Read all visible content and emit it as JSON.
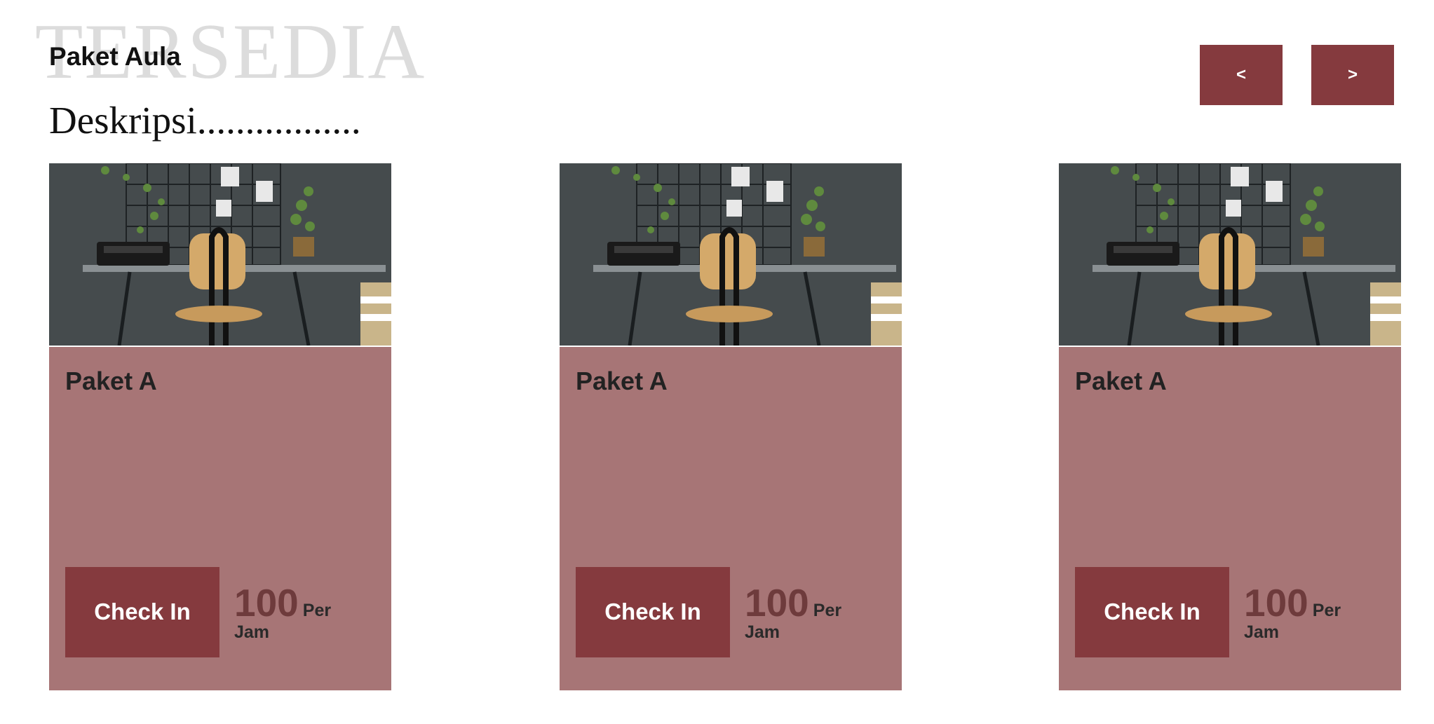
{
  "header": {
    "watermark": "TERSEDIA",
    "title": "Paket Aula",
    "description": "Deskripsi................."
  },
  "nav": {
    "prev_label": "<",
    "next_label": ">"
  },
  "cards": [
    {
      "title": "Paket A",
      "button_label": "Check In",
      "price": "100",
      "unit_top": "Per",
      "unit_bottom": "Jam",
      "image_icon": "desk-photo"
    },
    {
      "title": "Paket A",
      "button_label": "Check In",
      "price": "100",
      "unit_top": "Per",
      "unit_bottom": "Jam",
      "image_icon": "desk-photo"
    },
    {
      "title": "Paket A",
      "button_label": "Check In",
      "price": "100",
      "unit_top": "Per",
      "unit_bottom": "Jam",
      "image_icon": "desk-photo"
    }
  ],
  "colors": {
    "accent": "#853a3e",
    "card_body": "#a77576",
    "price": "#6e3b3c",
    "watermark": "#dcdcdc"
  }
}
